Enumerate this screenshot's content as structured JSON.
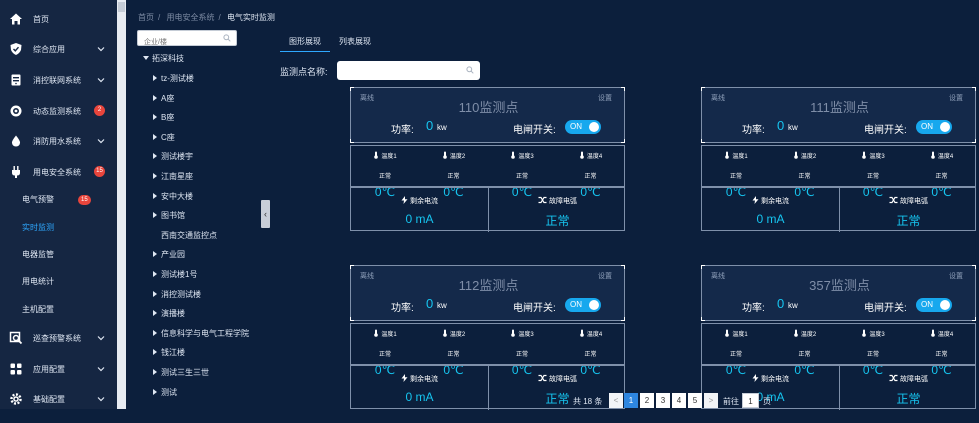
{
  "sidebar": {
    "items": [
      {
        "key": "home",
        "label": "首页",
        "icon": "home-icon"
      },
      {
        "key": "integrated",
        "label": "综合应用",
        "icon": "shield-icon"
      },
      {
        "key": "fire-net",
        "label": "消控联网系统",
        "icon": "server-icon"
      },
      {
        "key": "dynamic",
        "label": "动态监测系统",
        "icon": "radar-icon",
        "badge": "2"
      },
      {
        "key": "water",
        "label": "消防用水系统",
        "icon": "droplet-icon"
      },
      {
        "key": "electric",
        "label": "用电安全系统",
        "icon": "plug-icon",
        "badge": "15"
      },
      {
        "key": "patrol",
        "label": "巡查预警系统",
        "icon": "magnifier-icon"
      },
      {
        "key": "app-config",
        "label": "应用配置",
        "icon": "grid-icon"
      },
      {
        "key": "base-config",
        "label": "基础配置",
        "icon": "gear-icon"
      }
    ],
    "sub_items": [
      {
        "label": "电气预警",
        "badge": "15"
      },
      {
        "label": "实时监测"
      },
      {
        "label": "电器监管"
      },
      {
        "label": "用电统计"
      },
      {
        "label": "主机配置"
      }
    ]
  },
  "tree": {
    "search_placeholder": "企业/楼",
    "root": "拓深科技",
    "children": [
      "tz-测试楼",
      "A座",
      "B座",
      "C座",
      "测试楼宇",
      "江南星座",
      "安中大楼",
      "图书馆",
      "西南交通监控点",
      "产业园",
      "测试楼1号",
      "消控测试楼",
      "演播楼",
      "信息科学与电气工程学院",
      "钱江楼",
      "测试三生三世",
      "测试"
    ]
  },
  "breadcrumb": [
    "首页",
    "用电安全系统",
    "电气实时监测"
  ],
  "tabs": [
    "图形展现",
    "列表展现"
  ],
  "search": {
    "label": "监测点名称:",
    "placeholder": ""
  },
  "card_labels": {
    "status": "离线",
    "settings": "设置",
    "power": "功率:",
    "power_unit": "kw",
    "switch": "电闸开关:",
    "switch_on": "ON",
    "temps": [
      "温度1",
      "温度2",
      "温度3",
      "温度4"
    ],
    "temp_status": "正常",
    "residual": "剩余电流",
    "arc": "故障电弧"
  },
  "cards": [
    {
      "name": "110监测点",
      "power": "0",
      "temps": [
        "0℃",
        "0℃",
        "0℃",
        "0℃"
      ],
      "residual": "0 mA",
      "arc": "正常"
    },
    {
      "name": "111监测点",
      "power": "0",
      "temps": [
        "0℃",
        "0℃",
        "0℃",
        "0℃"
      ],
      "residual": "0 mA",
      "arc": "正常"
    },
    {
      "name": "112监测点",
      "power": "0",
      "temps": [
        "0℃",
        "0℃",
        "0℃",
        "0℃"
      ],
      "residual": "0 mA",
      "arc": "正常"
    },
    {
      "name": "357监测点",
      "power": "0",
      "temps": [
        "0℃",
        "0℃",
        "0℃",
        "0℃"
      ],
      "residual": "0 mA",
      "arc": "正常"
    }
  ],
  "pagination": {
    "total": "共 18 条",
    "pages": [
      "1",
      "2",
      "3",
      "4",
      "5"
    ],
    "goto_label": "前往",
    "goto_value": "1",
    "page_unit": "页",
    "prev": "<",
    "next": ">"
  },
  "colors": {
    "accent": "#16c5f0",
    "active_nav": "#2ea8ff",
    "badge": "#e8453c",
    "switch_on": "#17a8ee"
  }
}
